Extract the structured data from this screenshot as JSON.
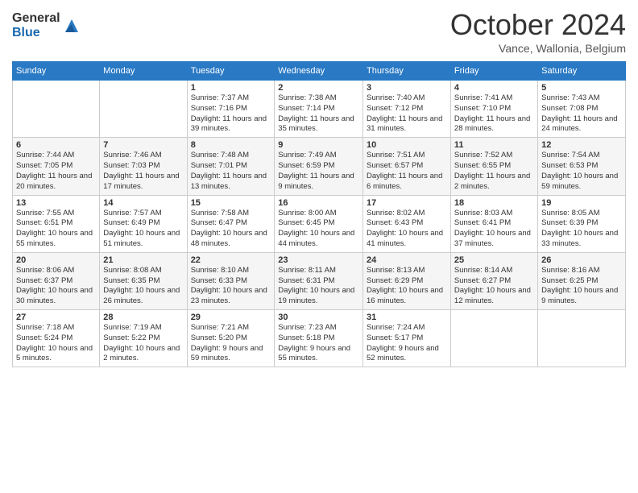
{
  "logo": {
    "general": "General",
    "blue": "Blue"
  },
  "title": "October 2024",
  "location": "Vance, Wallonia, Belgium",
  "days_header": [
    "Sunday",
    "Monday",
    "Tuesday",
    "Wednesday",
    "Thursday",
    "Friday",
    "Saturday"
  ],
  "weeks": [
    [
      {
        "day": "",
        "info": ""
      },
      {
        "day": "",
        "info": ""
      },
      {
        "day": "1",
        "info": "Sunrise: 7:37 AM\nSunset: 7:16 PM\nDaylight: 11 hours and 39 minutes."
      },
      {
        "day": "2",
        "info": "Sunrise: 7:38 AM\nSunset: 7:14 PM\nDaylight: 11 hours and 35 minutes."
      },
      {
        "day": "3",
        "info": "Sunrise: 7:40 AM\nSunset: 7:12 PM\nDaylight: 11 hours and 31 minutes."
      },
      {
        "day": "4",
        "info": "Sunrise: 7:41 AM\nSunset: 7:10 PM\nDaylight: 11 hours and 28 minutes."
      },
      {
        "day": "5",
        "info": "Sunrise: 7:43 AM\nSunset: 7:08 PM\nDaylight: 11 hours and 24 minutes."
      }
    ],
    [
      {
        "day": "6",
        "info": "Sunrise: 7:44 AM\nSunset: 7:05 PM\nDaylight: 11 hours and 20 minutes."
      },
      {
        "day": "7",
        "info": "Sunrise: 7:46 AM\nSunset: 7:03 PM\nDaylight: 11 hours and 17 minutes."
      },
      {
        "day": "8",
        "info": "Sunrise: 7:48 AM\nSunset: 7:01 PM\nDaylight: 11 hours and 13 minutes."
      },
      {
        "day": "9",
        "info": "Sunrise: 7:49 AM\nSunset: 6:59 PM\nDaylight: 11 hours and 9 minutes."
      },
      {
        "day": "10",
        "info": "Sunrise: 7:51 AM\nSunset: 6:57 PM\nDaylight: 11 hours and 6 minutes."
      },
      {
        "day": "11",
        "info": "Sunrise: 7:52 AM\nSunset: 6:55 PM\nDaylight: 11 hours and 2 minutes."
      },
      {
        "day": "12",
        "info": "Sunrise: 7:54 AM\nSunset: 6:53 PM\nDaylight: 10 hours and 59 minutes."
      }
    ],
    [
      {
        "day": "13",
        "info": "Sunrise: 7:55 AM\nSunset: 6:51 PM\nDaylight: 10 hours and 55 minutes."
      },
      {
        "day": "14",
        "info": "Sunrise: 7:57 AM\nSunset: 6:49 PM\nDaylight: 10 hours and 51 minutes."
      },
      {
        "day": "15",
        "info": "Sunrise: 7:58 AM\nSunset: 6:47 PM\nDaylight: 10 hours and 48 minutes."
      },
      {
        "day": "16",
        "info": "Sunrise: 8:00 AM\nSunset: 6:45 PM\nDaylight: 10 hours and 44 minutes."
      },
      {
        "day": "17",
        "info": "Sunrise: 8:02 AM\nSunset: 6:43 PM\nDaylight: 10 hours and 41 minutes."
      },
      {
        "day": "18",
        "info": "Sunrise: 8:03 AM\nSunset: 6:41 PM\nDaylight: 10 hours and 37 minutes."
      },
      {
        "day": "19",
        "info": "Sunrise: 8:05 AM\nSunset: 6:39 PM\nDaylight: 10 hours and 33 minutes."
      }
    ],
    [
      {
        "day": "20",
        "info": "Sunrise: 8:06 AM\nSunset: 6:37 PM\nDaylight: 10 hours and 30 minutes."
      },
      {
        "day": "21",
        "info": "Sunrise: 8:08 AM\nSunset: 6:35 PM\nDaylight: 10 hours and 26 minutes."
      },
      {
        "day": "22",
        "info": "Sunrise: 8:10 AM\nSunset: 6:33 PM\nDaylight: 10 hours and 23 minutes."
      },
      {
        "day": "23",
        "info": "Sunrise: 8:11 AM\nSunset: 6:31 PM\nDaylight: 10 hours and 19 minutes."
      },
      {
        "day": "24",
        "info": "Sunrise: 8:13 AM\nSunset: 6:29 PM\nDaylight: 10 hours and 16 minutes."
      },
      {
        "day": "25",
        "info": "Sunrise: 8:14 AM\nSunset: 6:27 PM\nDaylight: 10 hours and 12 minutes."
      },
      {
        "day": "26",
        "info": "Sunrise: 8:16 AM\nSunset: 6:25 PM\nDaylight: 10 hours and 9 minutes."
      }
    ],
    [
      {
        "day": "27",
        "info": "Sunrise: 7:18 AM\nSunset: 5:24 PM\nDaylight: 10 hours and 5 minutes."
      },
      {
        "day": "28",
        "info": "Sunrise: 7:19 AM\nSunset: 5:22 PM\nDaylight: 10 hours and 2 minutes."
      },
      {
        "day": "29",
        "info": "Sunrise: 7:21 AM\nSunset: 5:20 PM\nDaylight: 9 hours and 59 minutes."
      },
      {
        "day": "30",
        "info": "Sunrise: 7:23 AM\nSunset: 5:18 PM\nDaylight: 9 hours and 55 minutes."
      },
      {
        "day": "31",
        "info": "Sunrise: 7:24 AM\nSunset: 5:17 PM\nDaylight: 9 hours and 52 minutes."
      },
      {
        "day": "",
        "info": ""
      },
      {
        "day": "",
        "info": ""
      }
    ]
  ]
}
